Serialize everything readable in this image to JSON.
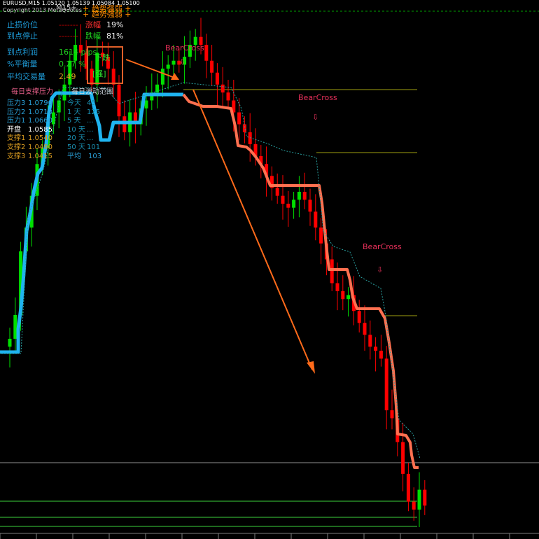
{
  "header": {
    "symbol_line": "EURUSD,M15  1.05120 1.05139 1.05084 1.05100",
    "copyright_line": "Copyright 2013 MetaQuotes"
  },
  "trend_title": {
    "line1": "+ 趋势强弱 +",
    "line2": "+ 趋势强弱 +",
    "m15": "M15+"
  },
  "stats": {
    "stop_loss_label": "止损价位",
    "target_label": "到点停止",
    "rise_label": "涨幅",
    "rise_value": "19%",
    "fall_label": "跌幅",
    "fall_value": "81%",
    "profit_label": "到点利润",
    "profit_value": "1614 pips",
    "balance_label": "%平衡量",
    "balance_value": "0.27 %",
    "avg_volume_label": "平均交易量",
    "avg_volume_value": "2.49"
  },
  "signal": {
    "direction": "下跌",
    "strength": "[强]"
  },
  "levels": {
    "daily_sr_label": "每日支撑压力",
    "daily_range_label": "每日波动范围",
    "rows": [
      {
        "label": "压力3",
        "value": "1.0790",
        "color": "#2aa0d8"
      },
      {
        "label": "压力2",
        "value": "1.0710",
        "color": "#2aa0d8"
      },
      {
        "label": "压力1",
        "value": "1.0660",
        "color": "#2aa0d8"
      },
      {
        "label": "开盘",
        "value": "1.0585",
        "color": "#ffffff"
      },
      {
        "label": "支撑1",
        "value": "1.0540",
        "color": "#d89a20"
      },
      {
        "label": "支撑2",
        "value": "1.0490",
        "color": "#d89a20"
      },
      {
        "label": "支撑3",
        "value": "1.0415",
        "color": "#d89a20"
      }
    ],
    "range_rows": [
      {
        "label": "今天",
        "value": "45"
      },
      {
        "label": "1 天",
        "value": "125"
      },
      {
        "label": "5 天",
        "value": "..."
      },
      {
        "label": "10 天",
        "value": "..."
      },
      {
        "label": "20 天",
        "value": "..."
      },
      {
        "label": "50 天",
        "value": "101"
      }
    ],
    "avg_label": "平均",
    "avg_value": "103"
  },
  "annotations": [
    "BearCross",
    "BearCross",
    "BearCross"
  ],
  "colors": {
    "background": "#000000",
    "bull_candle": "#00e000",
    "bear_candle": "#ff0000",
    "uptrend_line": "#1fb4f0",
    "downtrend_line": "#ff7050",
    "arrow": "#ff6a1a",
    "support_lines": "#3cd23c",
    "level_lines": "#a0a010"
  },
  "chart_data": {
    "type": "candlestick",
    "symbol": "EURUSD",
    "timeframe": "M15",
    "last_ohlc": {
      "open": 1.0512,
      "high": 1.05139,
      "low": 1.05084,
      "close": 1.051
    },
    "close_path": [
      1.042,
      1.045,
      1.053,
      1.056,
      1.06,
      1.064,
      1.066,
      1.069,
      1.0705,
      1.072,
      1.074,
      1.077,
      1.079,
      1.078,
      1.076,
      1.074,
      1.078,
      1.0775,
      1.076,
      1.074,
      1.07,
      1.068,
      1.0705,
      1.069,
      1.071,
      1.072,
      1.073,
      1.074,
      1.076,
      1.0765,
      1.077,
      1.0765,
      1.0775,
      1.079,
      1.08,
      1.079,
      1.077,
      1.0755,
      1.074,
      1.073,
      1.072,
      1.0705,
      1.069,
      1.068,
      1.0665,
      1.065,
      1.064,
      1.0625,
      1.061,
      1.06,
      1.059,
      1.0585,
      1.0595,
      1.0605,
      1.0595,
      1.058,
      1.056,
      1.054,
      1.052,
      1.049,
      1.048,
      1.047,
      1.0475,
      1.0455,
      1.044,
      1.0425,
      1.041,
      1.0405,
      1.0395,
      1.033,
      1.032,
      1.029,
      1.025,
      1.0215,
      1.0205,
      1.023,
      1.021
    ]
  }
}
